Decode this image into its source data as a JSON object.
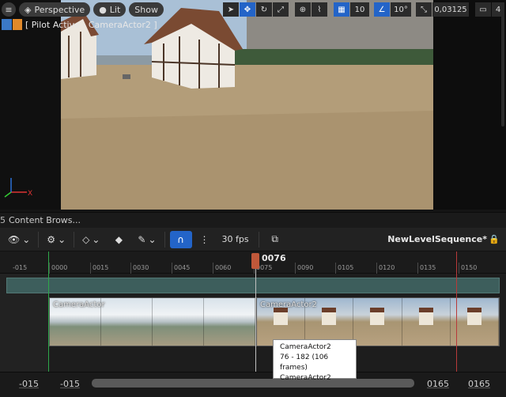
{
  "viewport": {
    "menu_icon": "hamburger-icon",
    "perspective_label": "Perspective",
    "lit_label": "Lit",
    "show_label": "Show",
    "grid_snap": "10",
    "rotation_snap": "10°",
    "scale_snap": "0,03125",
    "camera_speed": "4",
    "pilot_label": "[ Pilot Active - CameraActor2 ]"
  },
  "content_browser": {
    "number": "5",
    "label": "Content Brows..."
  },
  "sequencer": {
    "fps_label": "30 fps",
    "sequence_name": "NewLevelSequence*",
    "playhead_frame": "0076",
    "ruler_labels": [
      "-015",
      "0000",
      "0015",
      "0030",
      "0045",
      "0060",
      "0075",
      "0090",
      "0105",
      "0120",
      "0135",
      "0150"
    ],
    "shots": [
      {
        "name": "CameraActor"
      },
      {
        "name": "CameraActor2"
      }
    ],
    "tooltip": {
      "line1": "CameraActor2",
      "line2": "76 - 182 (106 frames)",
      "line3": "CameraActor2"
    },
    "bottom": {
      "view_start": "-015",
      "work_start": "-015",
      "work_end": "0165",
      "view_end": "0165"
    }
  },
  "colors": {
    "accent": "#2364c8",
    "playhead": "#c0583a",
    "start_marker": "#2ea84a",
    "end_marker": "#b83a3a"
  }
}
